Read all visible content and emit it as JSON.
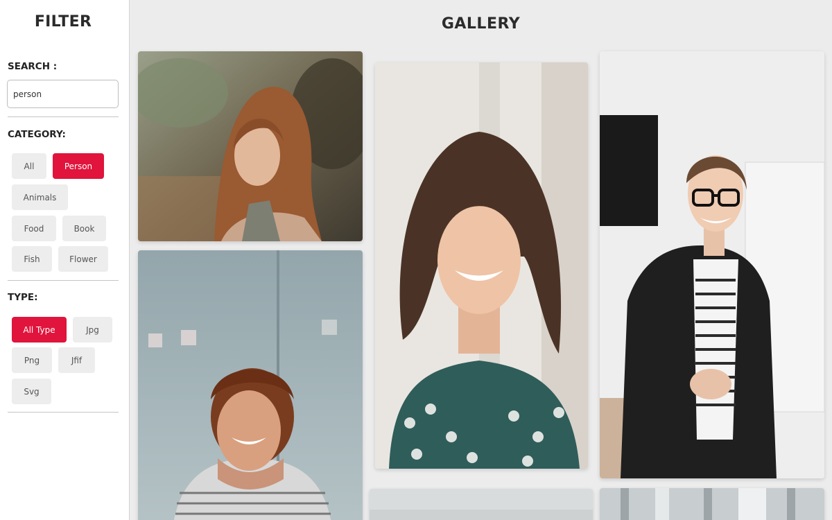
{
  "sidebar": {
    "title": "FILTER",
    "search": {
      "label": "SEARCH :",
      "value": "person",
      "placeholder": ""
    },
    "category": {
      "label": "CATEGORY:",
      "options": [
        "All",
        "Person",
        "Animals",
        "Food",
        "Book",
        "Fish",
        "Flower"
      ],
      "selected": "Person"
    },
    "type": {
      "label": "TYPE:",
      "options": [
        "All Type",
        "Jpg",
        "Png",
        "Jfif",
        "Svg"
      ],
      "selected": "All Type"
    }
  },
  "main": {
    "title": "GALLERY",
    "photos": [
      {
        "subject": "woman with long auburn hair outdoors"
      },
      {
        "subject": "smiling woman with curly dark hair, patterned shirt"
      },
      {
        "subject": "smiling woman with glasses in black blazer, office"
      },
      {
        "subject": "smiling woman with short curly hair, striped top"
      },
      {
        "subject": "partially visible photo"
      },
      {
        "subject": "partially visible photo"
      }
    ]
  },
  "colors": {
    "accent": "#e0143c",
    "chip": "#ededed",
    "background": "#ececec"
  }
}
